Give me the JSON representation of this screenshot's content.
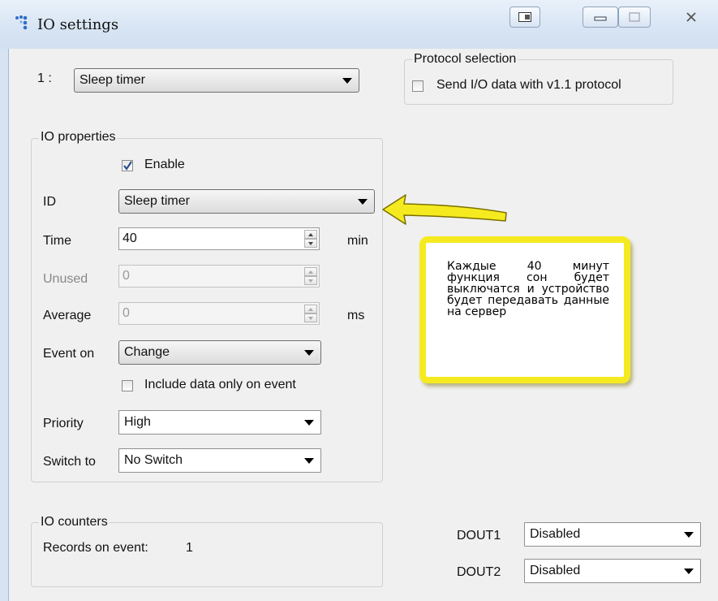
{
  "window": {
    "title": "IO settings"
  },
  "io_select": {
    "index_label": "1 :",
    "value": "Sleep timer"
  },
  "protocol": {
    "legend": "Protocol selection",
    "checkbox_label": "Send I/O data with v1.1 protocol",
    "checked": false
  },
  "properties": {
    "legend": "IO properties",
    "enable_label": "Enable",
    "enable_checked": true,
    "id_label": "ID",
    "id_value": "Sleep timer",
    "time_label": "Time",
    "time_value": "40",
    "time_unit": "min",
    "unused_label": "Unused",
    "unused_value": "0",
    "average_label": "Average",
    "average_value": "0",
    "average_unit": "ms",
    "event_label": "Event on",
    "event_value": "Change",
    "include_label": "Include data only on event",
    "include_checked": false,
    "priority_label": "Priority",
    "priority_value": "High",
    "switch_label": "Switch to",
    "switch_value": "No Switch"
  },
  "counters": {
    "legend": "IO counters",
    "records_label": "Records on event:",
    "records_value": "1"
  },
  "outputs": [
    {
      "label": "DOUT1",
      "value": "Disabled"
    },
    {
      "label": "DOUT2",
      "value": "Disabled"
    }
  ],
  "annotation": {
    "text": "Каждые 40 минут функция сон будет выключатся и устройство будет передавать данные на сервер"
  },
  "colors": {
    "highlight": "#f5ea1f",
    "title_bar": "#d7e4f3",
    "client_bg": "#f0f0f0"
  }
}
